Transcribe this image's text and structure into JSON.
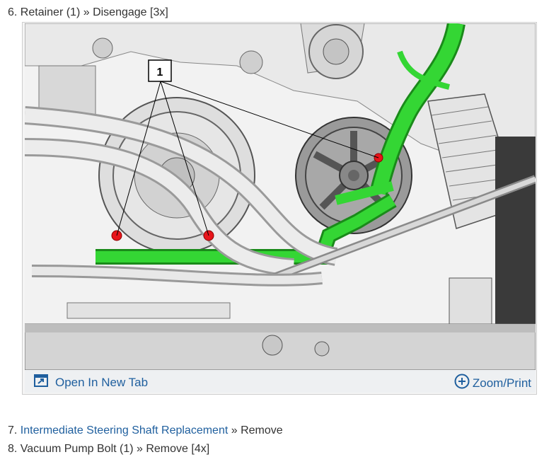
{
  "steps": {
    "step6": {
      "number": "6.",
      "text": "Retainer (1) » Disengage [3x]"
    },
    "step7": {
      "number": "7.",
      "link": "Intermediate Steering Shaft Replacement",
      "suffix": "» Remove"
    },
    "step8": {
      "number": "8.",
      "text": "Vacuum Pump Bolt (1) » Remove [4x]"
    }
  },
  "figure": {
    "callout": "1",
    "open_tab_label": "Open In New Tab",
    "zoom_label": "Zoom/Print",
    "icons": {
      "open_tab": "open-new-tab-icon",
      "zoom": "zoom-plus-icon"
    },
    "colors": {
      "link": "#1f5f9e",
      "highlight": "#2fd62f",
      "retainer": "#e8151b",
      "bar": "#eef0f2"
    }
  }
}
